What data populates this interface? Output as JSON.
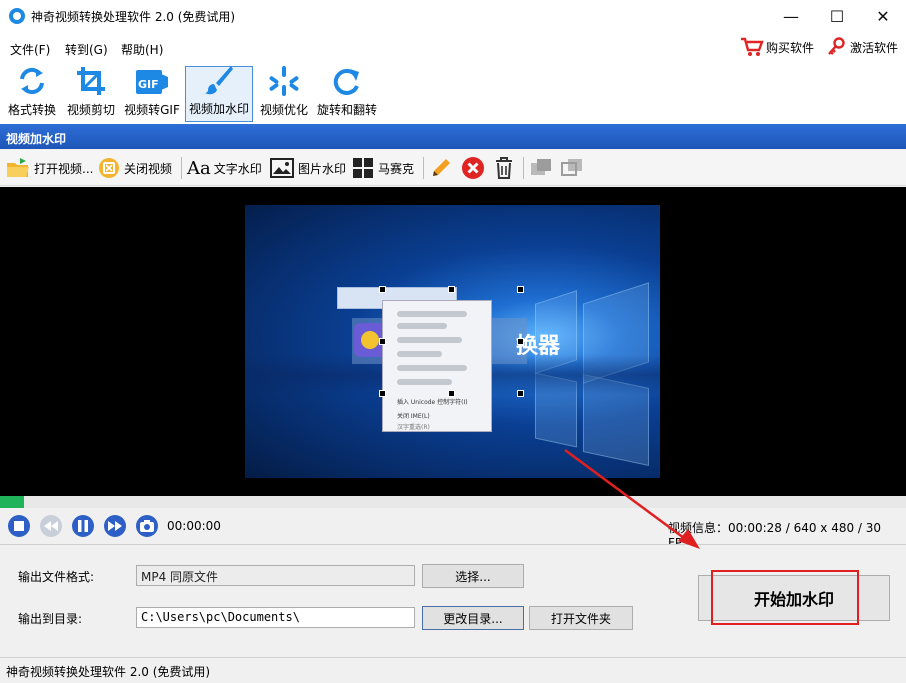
{
  "window": {
    "title": "神奇视频转换处理软件 2.0 (免费试用)",
    "controls": {
      "minimize": "—",
      "maximize": "☐",
      "close": "✕"
    }
  },
  "menu": {
    "items": [
      {
        "label": "文件(F)"
      },
      {
        "label": "转到(G)"
      },
      {
        "label": "帮助(H)"
      }
    ],
    "buy": "购买软件",
    "activate": "激活软件"
  },
  "toolbar": {
    "tools": [
      {
        "label": "格式转换",
        "icon": "refresh-arrows-icon"
      },
      {
        "label": "视频剪切",
        "icon": "crop-icon"
      },
      {
        "label": "视频转GIF",
        "icon": "gif-icon",
        "badge": "GIF"
      },
      {
        "label": "视频加水印",
        "icon": "brush-icon",
        "active": true
      },
      {
        "label": "视频优化",
        "icon": "sparkle-icon"
      },
      {
        "label": "旋转和翻转",
        "icon": "rotate-icon"
      }
    ]
  },
  "section": {
    "title": "视频加水印"
  },
  "wm_toolbar": {
    "open_video": "打开视频...",
    "close_video": "关闭视频",
    "text_watermark": "文字水印",
    "text_icon_glyph": "Aa",
    "image_watermark": "图片水印",
    "mosaic": "马赛克"
  },
  "preview": {
    "blurred_title_suffix": "换器",
    "ctx_menu": {
      "item1": "插入 Unicode 控制字符(I)",
      "item2": "关闭 IME(L)",
      "item3": "汉字重选(R)"
    }
  },
  "progress": {
    "value": 0.027
  },
  "playback": {
    "time": "00:00:00",
    "info": "视频信息：00:00:28 / 640 x 480 / 30 FPS"
  },
  "output": {
    "format_label": "输出文件格式:",
    "format_value": "MP4 同原文件",
    "select_btn": "选择...",
    "dir_label": "输出到目录:",
    "dir_value": "C:\\Users\\pc\\Documents\\",
    "change_dir_btn": "更改目录...",
    "open_folder_btn": "打开文件夹",
    "start_btn": "开始加水印"
  },
  "status": {
    "text": "神奇视频转换处理软件 2.0 (免费试用)"
  },
  "colors": {
    "accent": "#1d56b7",
    "progress": "#21b35a",
    "highlight": "#e02020"
  }
}
